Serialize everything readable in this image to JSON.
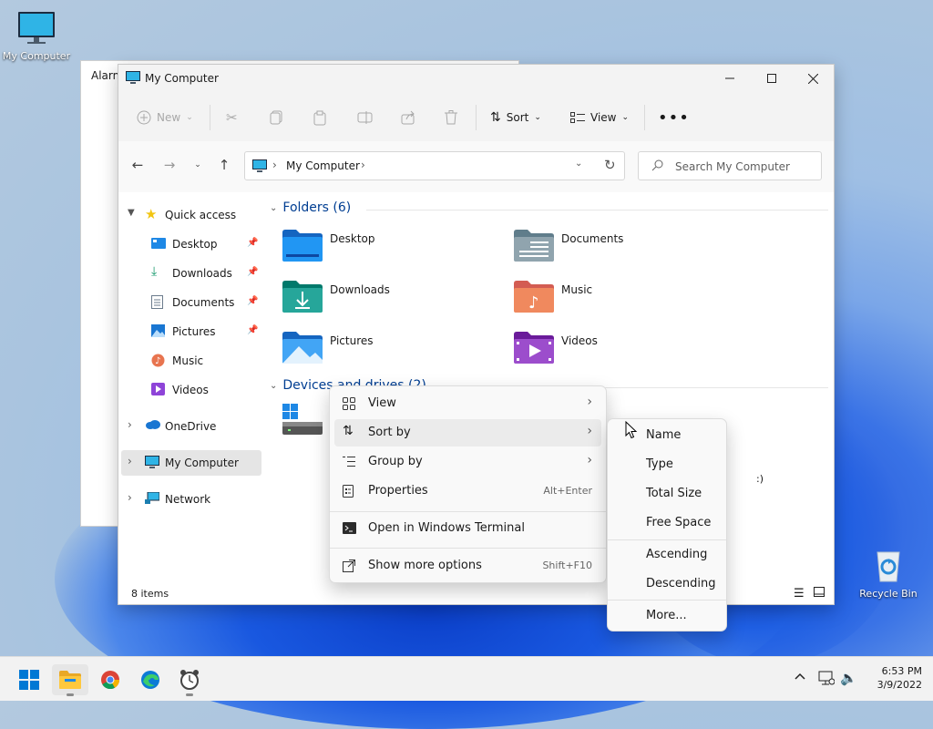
{
  "desktop": {
    "icons": [
      {
        "label": "My Computer"
      },
      {
        "label": "Recycle Bin"
      }
    ]
  },
  "background_window": {
    "title": "Alarm"
  },
  "window": {
    "title": "My Computer",
    "toolbar": {
      "new_label": "New",
      "sort_label": "Sort",
      "view_label": "View"
    },
    "address": {
      "path": "My Computer"
    },
    "search": {
      "placeholder": "Search My Computer"
    },
    "sidebar": {
      "quick_access": "Quick access",
      "items": [
        {
          "label": "Desktop"
        },
        {
          "label": "Downloads"
        },
        {
          "label": "Documents"
        },
        {
          "label": "Pictures"
        },
        {
          "label": "Music"
        },
        {
          "label": "Videos"
        }
      ],
      "onedrive": "OneDrive",
      "my_computer": "My Computer",
      "network": "Network"
    },
    "main": {
      "folders_header": "Folders (6)",
      "folders": [
        {
          "label": "Desktop"
        },
        {
          "label": "Documents"
        },
        {
          "label": "Downloads"
        },
        {
          "label": "Music"
        },
        {
          "label": "Pictures"
        },
        {
          "label": "Videos"
        }
      ],
      "devices_header": "Devices and drives (2)",
      "drive_label_fragment": ":)"
    },
    "status": {
      "item_count": "8 items"
    }
  },
  "context_menu": {
    "items": [
      {
        "label": "View",
        "shortcut": ""
      },
      {
        "label": "Sort by",
        "shortcut": ""
      },
      {
        "label": "Group by",
        "shortcut": ""
      },
      {
        "label": "Properties",
        "shortcut": "Alt+Enter"
      },
      {
        "label": "Open in Windows Terminal",
        "shortcut": ""
      },
      {
        "label": "Show more options",
        "shortcut": "Shift+F10"
      }
    ]
  },
  "sort_submenu": {
    "items": [
      {
        "label": "Name"
      },
      {
        "label": "Type"
      },
      {
        "label": "Total Size"
      },
      {
        "label": "Free Space"
      },
      {
        "label": "Ascending"
      },
      {
        "label": "Descending"
      },
      {
        "label": "More..."
      }
    ]
  },
  "taskbar": {
    "time": "6:53 PM",
    "date": "3/9/2022"
  },
  "colors": {
    "accent": "#0067c0",
    "group_header": "#003e92"
  }
}
